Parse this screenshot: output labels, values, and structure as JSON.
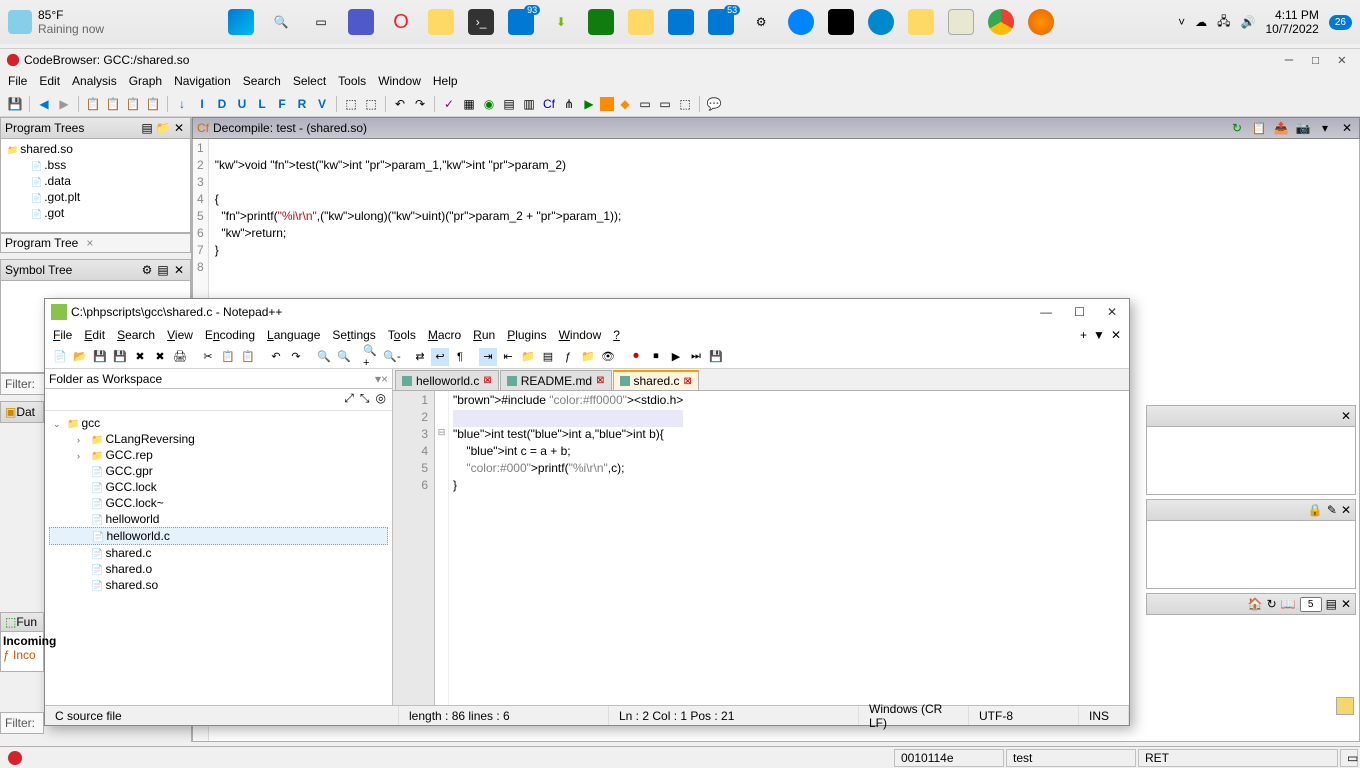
{
  "taskbar": {
    "weather_temp": "85°F",
    "weather_desc": "Raining now",
    "badge1": "93",
    "badge2": "53",
    "time": "4:11 PM",
    "date": "10/7/2022",
    "notif_count": "26"
  },
  "ghidra": {
    "title": "CodeBrowser: GCC:/shared.so",
    "menu": [
      "File",
      "Edit",
      "Analysis",
      "Graph",
      "Navigation",
      "Search",
      "Select",
      "Tools",
      "Window",
      "Help"
    ],
    "program_trees": {
      "title": "Program Trees",
      "root": "shared.so",
      "items": [
        ".bss",
        ".data",
        ".got.plt",
        ".got"
      ],
      "tab": "Program Tree"
    },
    "symbol_tree": {
      "title": "Symbol Tree"
    },
    "data_type": {
      "title": "Dat"
    },
    "fun_panel": {
      "title": "Fun",
      "incoming_hdr": "Incoming",
      "incoming_item": "Inco"
    },
    "filter_label": "Filter:",
    "decompile": {
      "title": "Decompile: test -  (shared.so)",
      "lines": [
        {
          "n": "1",
          "t": ""
        },
        {
          "n": "2",
          "t": "void test(int param_1,int param_2)"
        },
        {
          "n": "3",
          "t": ""
        },
        {
          "n": "4",
          "t": "{"
        },
        {
          "n": "5",
          "t": "  printf(\"%i\\r\\n\",(ulong)(uint)(param_2 + param_1));"
        },
        {
          "n": "6",
          "t": "  return;"
        },
        {
          "n": "7",
          "t": "}"
        },
        {
          "n": "8",
          "t": ""
        }
      ]
    },
    "right_spinner_value": "5",
    "status": {
      "addr": "0010114e",
      "fn": "test",
      "instr": "RET"
    }
  },
  "npp": {
    "title": "C:\\phpscripts\\gcc\\shared.c - Notepad++",
    "menu": [
      "File",
      "Edit",
      "Search",
      "View",
      "Encoding",
      "Language",
      "Settings",
      "Tools",
      "Macro",
      "Run",
      "Plugins",
      "Window",
      "?"
    ],
    "side_title": "Folder as Workspace",
    "tree": {
      "root": "gcc",
      "folders": [
        "CLangReversing",
        "GCC.rep"
      ],
      "files": [
        "GCC.gpr",
        "GCC.lock",
        "GCC.lock~",
        "helloworld",
        "helloworld.c",
        "shared.c",
        "shared.o",
        "shared.so"
      ],
      "selected": "helloworld.c"
    },
    "tabs": [
      {
        "name": "helloworld.c",
        "active": false
      },
      {
        "name": "README.md",
        "active": false
      },
      {
        "name": "shared.c",
        "active": true
      }
    ],
    "code": [
      {
        "n": "1",
        "t": "#include <stdio.h>"
      },
      {
        "n": "2",
        "t": ""
      },
      {
        "n": "3",
        "t": "int test(int a,int b){"
      },
      {
        "n": "4",
        "t": "    int c = a + b;"
      },
      {
        "n": "5",
        "t": "    printf(\"%i\\r\\n\",c);"
      },
      {
        "n": "6",
        "t": "}"
      }
    ],
    "status": {
      "type": "C source file",
      "length": "length : 86    lines : 6",
      "pos": "Ln : 2    Col : 1    Pos : 21",
      "eol": "Windows (CR LF)",
      "enc": "UTF-8",
      "mode": "INS"
    }
  }
}
